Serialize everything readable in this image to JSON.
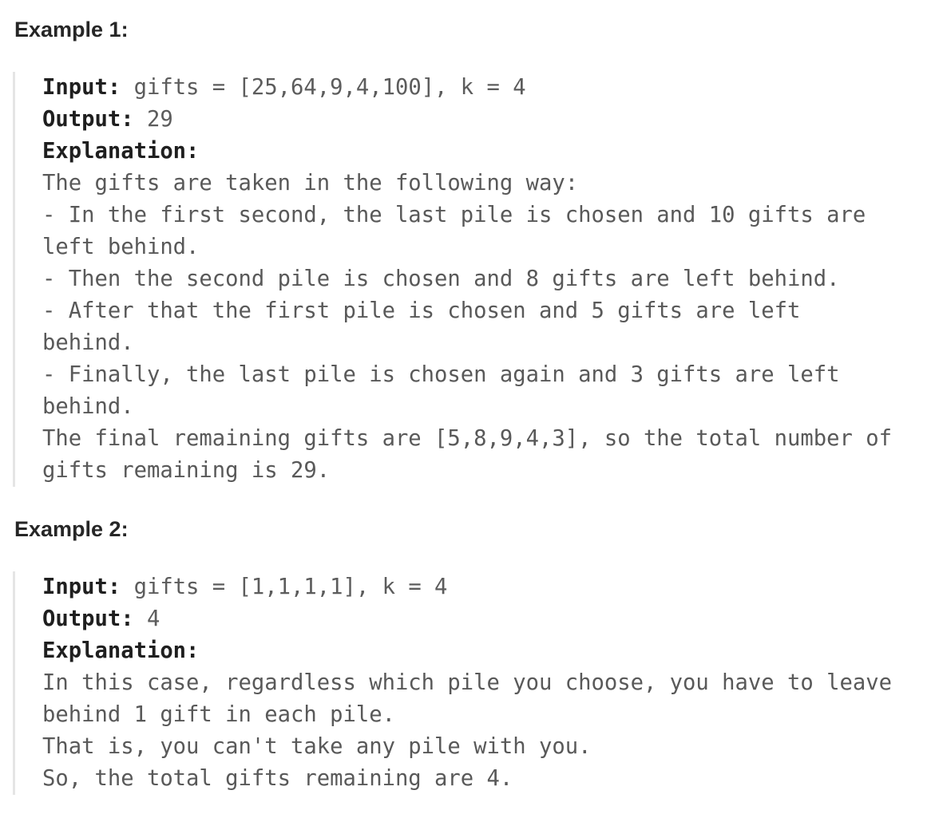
{
  "examples": [
    {
      "title": "Example 1:",
      "input_label": "Input:",
      "input_value": " gifts = [25,64,9,4,100], k = 4",
      "output_label": "Output:",
      "output_value": " 29",
      "explanation_label": "Explanation:",
      "explanation_lines": [
        "The gifts are taken in the following way:",
        "- In the first second, the last pile is chosen and 10 gifts are",
        "left behind.",
        "- Then the second pile is chosen and 8 gifts are left behind.",
        "- After that the first pile is chosen and 5 gifts are left",
        "behind.",
        "- Finally, the last pile is chosen again and 3 gifts are left",
        "behind.",
        "The final remaining gifts are [5,8,9,4,3], so the total number of",
        "gifts remaining is 29."
      ]
    },
    {
      "title": "Example 2:",
      "input_label": "Input:",
      "input_value": " gifts = [1,1,1,1], k = 4",
      "output_label": "Output:",
      "output_value": " 4",
      "explanation_label": "Explanation:",
      "explanation_lines": [
        "In this case, regardless which pile you choose, you have to leave",
        "behind 1 gift in each pile.",
        "That is, you can't take any pile with you.",
        "So, the total gifts remaining are 4."
      ]
    }
  ]
}
